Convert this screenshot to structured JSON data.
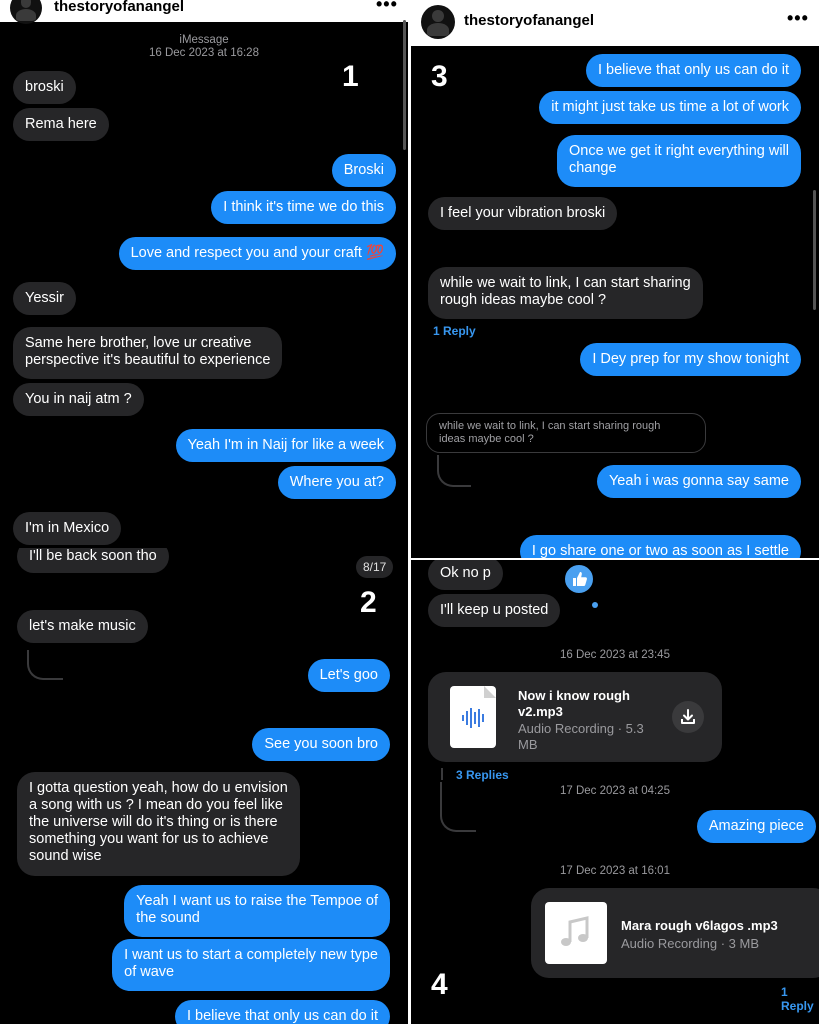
{
  "username": "thestoryofanangel",
  "more_label": "•••",
  "panels": {
    "p1": {
      "number": "1",
      "service_label": "iMessage",
      "timestamp": "16 Dec 2023 at 16:28",
      "messages": [
        "broski",
        "Rema here",
        "Broski",
        "I think it's time we do this",
        "Love and respect you and your craft 💯",
        "Yessir",
        "Same here brother, love ur creative",
        "perspective it's beautiful to experience",
        "You in naij atm ?",
        "Yeah I'm in Naij for like a week",
        "Where you at?",
        "I'm in Mexico"
      ]
    },
    "p2": {
      "number": "2",
      "counter": "8/17",
      "messages": [
        "I'll be back soon tho",
        "let's make music",
        "Let's goo",
        "See you soon bro",
        "I gotta question yeah, how do u envision",
        "a song with us ? I mean do you feel like",
        "the universe will do it's thing or is there",
        "something you want for us to achieve",
        "sound wise",
        "Yeah I want us to raise the Tempoe of",
        "the sound",
        "I want us to start a completely new type",
        "of wave",
        "I believe that only us can do it"
      ]
    },
    "p3": {
      "number": "3",
      "messages": [
        "I believe that only us can do it",
        "it might just take us time a lot of work",
        "Once we get it right everything will",
        "change",
        "I feel your vibration broski",
        "while we wait to link, I can start sharing",
        "rough ideas maybe cool ?",
        "I Dey prep for my show tonight",
        "Yeah i was gonna say same",
        "I go share one or two as soon as I settle"
      ],
      "reply_label": "1 Reply",
      "quoted_line1": "while we wait to link, I can start sharing rough",
      "quoted_line2": "ideas maybe cool ?"
    },
    "p4": {
      "number": "4",
      "messages": [
        "Ok no p",
        "I'll keep u posted",
        "Amazing piece"
      ],
      "timestamps": [
        "16 Dec 2023 at 23:45",
        "17 Dec 2023 at 04:25",
        "17 Dec 2023 at 16:01"
      ],
      "file1": {
        "name_line1": "Now i know rough",
        "name_line2": "v2.mp3",
        "meta_line1": "Audio Recording · 5.3",
        "meta_line2": "MB"
      },
      "file2": {
        "name": "Mara rough v6lagos .mp3",
        "meta": "Audio Recording · 3 MB"
      },
      "replies_label": "3 Replies",
      "reply_label": "1 Reply"
    }
  },
  "colors": {
    "incoming_bubble": "#262628",
    "outgoing_bubble": "#1d8cf8",
    "link_blue": "#3897f0",
    "background": "#000000"
  },
  "icons": [
    "avatar",
    "more-options-icon",
    "audio-file-icon",
    "download-icon",
    "music-note-icon",
    "thumbs-up-reaction-icon"
  ]
}
